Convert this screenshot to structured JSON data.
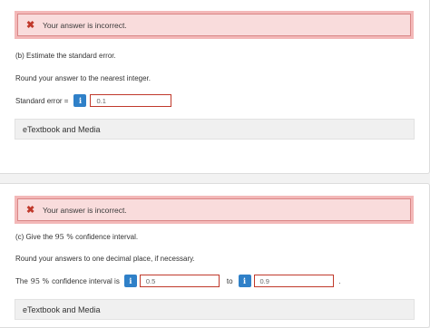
{
  "part_b": {
    "error_message": "Your answer is incorrect.",
    "question": "(b) Estimate the standard error.",
    "rounding_instruction": "Round your answer to the nearest integer.",
    "field_label": "Standard error =",
    "info_icon_glyph": "i",
    "answer_value": "0.1",
    "media_label": "eTextbook and Media"
  },
  "part_c": {
    "error_message": "Your answer is incorrect.",
    "question_prefix": "(c) Give the",
    "question_percent": "95 %",
    "question_suffix": "confidence interval.",
    "rounding_instruction": "Round your answers to one decimal place, if necessary.",
    "label_prefix": "The",
    "label_percent": "95 %",
    "label_suffix": "confidence interval is",
    "info_icon_glyph": "i",
    "lower_value": "0.5",
    "to_label": "to",
    "upper_value": "0.9",
    "period": ".",
    "media_label": "eTextbook and Media"
  },
  "colors": {
    "error_bg": "#f9dcdc",
    "error_border": "#d98686",
    "error_icon": "#c0392b",
    "info_button": "#2f80c8",
    "field_border_incorrect": "#c0392b"
  },
  "icons": {
    "error": "close-x-icon",
    "info": "info-icon"
  }
}
